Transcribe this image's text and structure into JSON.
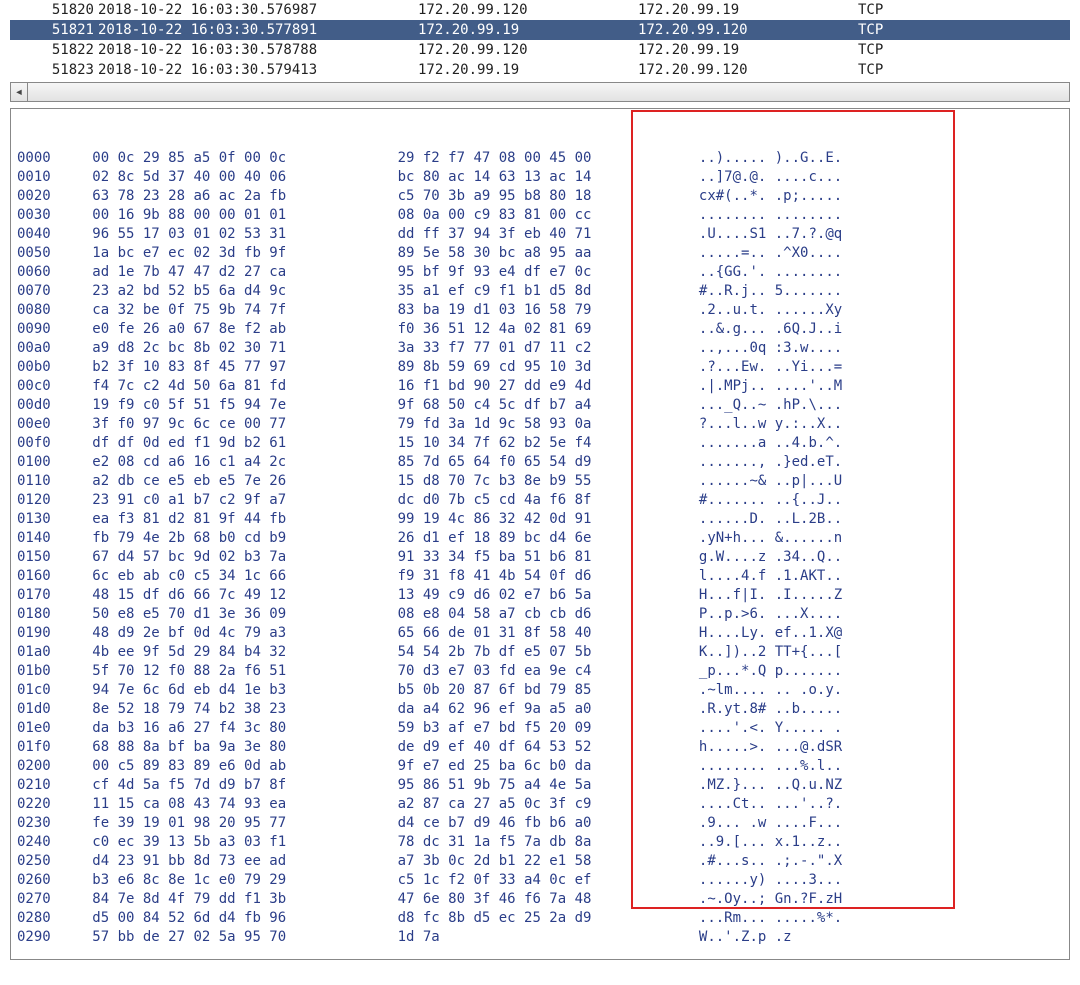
{
  "packet_list": {
    "rows": [
      {
        "no": "51820",
        "time": "2018-10-22 16:03:30.576987",
        "src": "172.20.99.120",
        "dst": "172.20.99.19",
        "proto": "TCP",
        "selected": false
      },
      {
        "no": "51821",
        "time": "2018-10-22 16:03:30.577891",
        "src": "172.20.99.19",
        "dst": "172.20.99.120",
        "proto": "TCP",
        "selected": true
      },
      {
        "no": "51822",
        "time": "2018-10-22 16:03:30.578788",
        "src": "172.20.99.120",
        "dst": "172.20.99.19",
        "proto": "TCP",
        "selected": false
      },
      {
        "no": "51823",
        "time": "2018-10-22 16:03:30.579413",
        "src": "172.20.99.19",
        "dst": "172.20.99.120",
        "proto": "TCP",
        "selected": false
      }
    ]
  },
  "scroll": {
    "left_arrow": "◂"
  },
  "hex_dump": {
    "rows": [
      {
        "off": "0000",
        "b1": "00 0c 29 85 a5 0f 00 0c",
        "b2": "29 f2 f7 47 08 00 45 00",
        "asc": "..)..... )..G..E."
      },
      {
        "off": "0010",
        "b1": "02 8c 5d 37 40 00 40 06",
        "b2": "bc 80 ac 14 63 13 ac 14",
        "asc": "..]7@.@. ....c..."
      },
      {
        "off": "0020",
        "b1": "63 78 23 28 a6 ac 2a fb",
        "b2": "c5 70 3b a9 95 b8 80 18",
        "asc": "cx#(..*. .p;....."
      },
      {
        "off": "0030",
        "b1": "00 16 9b 88 00 00 01 01",
        "b2": "08 0a 00 c9 83 81 00 cc",
        "asc": "........ ........"
      },
      {
        "off": "0040",
        "b1": "96 55 17 03 01 02 53 31",
        "b2": "dd ff 37 94 3f eb 40 71",
        "asc": ".U....S1 ..7.?.@q"
      },
      {
        "off": "0050",
        "b1": "1a bc e7 ec 02 3d fb 9f",
        "b2": "89 5e 58 30 bc a8 95 aa",
        "asc": ".....=.. .^X0...."
      },
      {
        "off": "0060",
        "b1": "ad 1e 7b 47 47 d2 27 ca",
        "b2": "95 bf 9f 93 e4 df e7 0c",
        "asc": "..{GG.'. ........"
      },
      {
        "off": "0070",
        "b1": "23 a2 bd 52 b5 6a d4 9c",
        "b2": "35 a1 ef c9 f1 b1 d5 8d",
        "asc": "#..R.j.. 5......."
      },
      {
        "off": "0080",
        "b1": "ca 32 be 0f 75 9b 74 7f",
        "b2": "83 ba 19 d1 03 16 58 79",
        "asc": ".2..u.t. ......Xy"
      },
      {
        "off": "0090",
        "b1": "e0 fe 26 a0 67 8e f2 ab",
        "b2": "f0 36 51 12 4a 02 81 69",
        "asc": "..&.g... .6Q.J..i"
      },
      {
        "off": "00a0",
        "b1": "a9 d8 2c bc 8b 02 30 71",
        "b2": "3a 33 f7 77 01 d7 11 c2",
        "asc": "..,...0q :3.w...."
      },
      {
        "off": "00b0",
        "b1": "b2 3f 10 83 8f 45 77 97",
        "b2": "89 8b 59 69 cd 95 10 3d",
        "asc": ".?...Ew. ..Yi...="
      },
      {
        "off": "00c0",
        "b1": "f4 7c c2 4d 50 6a 81 fd",
        "b2": "16 f1 bd 90 27 dd e9 4d",
        "asc": ".|.MPj.. ....'..M"
      },
      {
        "off": "00d0",
        "b1": "19 f9 c0 5f 51 f5 94 7e",
        "b2": "9f 68 50 c4 5c df b7 a4",
        "asc": "..._Q..~ .hP.\\..."
      },
      {
        "off": "00e0",
        "b1": "3f f0 97 9c 6c ce 00 77",
        "b2": "79 fd 3a 1d 9c 58 93 0a",
        "asc": "?...l..w y.:..X.."
      },
      {
        "off": "00f0",
        "b1": "df df 0d ed f1 9d b2 61",
        "b2": "15 10 34 7f 62 b2 5e f4",
        "asc": ".......a ..4.b.^."
      },
      {
        "off": "0100",
        "b1": "e2 08 cd a6 16 c1 a4 2c",
        "b2": "85 7d 65 64 f0 65 54 d9",
        "asc": "......., .}ed.eT."
      },
      {
        "off": "0110",
        "b1": "a2 db ce e5 eb e5 7e 26",
        "b2": "15 d8 70 7c b3 8e b9 55",
        "asc": "......~& ..p|...U"
      },
      {
        "off": "0120",
        "b1": "23 91 c0 a1 b7 c2 9f a7",
        "b2": "dc d0 7b c5 cd 4a f6 8f",
        "asc": "#....... ..{..J.."
      },
      {
        "off": "0130",
        "b1": "ea f3 81 d2 81 9f 44 fb",
        "b2": "99 19 4c 86 32 42 0d 91",
        "asc": "......D. ..L.2B.."
      },
      {
        "off": "0140",
        "b1": "fb 79 4e 2b 68 b0 cd b9",
        "b2": "26 d1 ef 18 89 bc d4 6e",
        "asc": ".yN+h... &......n"
      },
      {
        "off": "0150",
        "b1": "67 d4 57 bc 9d 02 b3 7a",
        "b2": "91 33 34 f5 ba 51 b6 81",
        "asc": "g.W....z .34..Q.."
      },
      {
        "off": "0160",
        "b1": "6c eb ab c0 c5 34 1c 66",
        "b2": "f9 31 f8 41 4b 54 0f d6",
        "asc": "l....4.f .1.AKT.."
      },
      {
        "off": "0170",
        "b1": "48 15 df d6 66 7c 49 12",
        "b2": "13 49 c9 d6 02 e7 b6 5a",
        "asc": "H...f|I. .I.....Z"
      },
      {
        "off": "0180",
        "b1": "50 e8 e5 70 d1 3e 36 09",
        "b2": "08 e8 04 58 a7 cb cb d6",
        "asc": "P..p.>6. ...X...."
      },
      {
        "off": "0190",
        "b1": "48 d9 2e bf 0d 4c 79 a3",
        "b2": "65 66 de 01 31 8f 58 40",
        "asc": "H....Ly. ef..1.X@"
      },
      {
        "off": "01a0",
        "b1": "4b ee 9f 5d 29 84 b4 32",
        "b2": "54 54 2b 7b df e5 07 5b",
        "asc": "K..])..2 TT+{...["
      },
      {
        "off": "01b0",
        "b1": "5f 70 12 f0 88 2a f6 51",
        "b2": "70 d3 e7 03 fd ea 9e c4",
        "asc": "_p...*.Q p......."
      },
      {
        "off": "01c0",
        "b1": "94 7e 6c 6d eb d4 1e b3",
        "b2": "b5 0b 20 87 6f bd 79 85",
        "asc": ".~lm.... .. .o.y."
      },
      {
        "off": "01d0",
        "b1": "8e 52 18 79 74 b2 38 23",
        "b2": "da a4 62 96 ef 9a a5 a0",
        "asc": ".R.yt.8# ..b....."
      },
      {
        "off": "01e0",
        "b1": "da b3 16 a6 27 f4 3c 80",
        "b2": "59 b3 af e7 bd f5 20 09",
        "asc": "....'.<. Y..... ."
      },
      {
        "off": "01f0",
        "b1": "68 88 8a bf ba 9a 3e 80",
        "b2": "de d9 ef 40 df 64 53 52",
        "asc": "h.....>. ...@.dSR"
      },
      {
        "off": "0200",
        "b1": "00 c5 89 83 89 e6 0d ab",
        "b2": "9f e7 ed 25 ba 6c b0 da",
        "asc": "........ ...%.l.."
      },
      {
        "off": "0210",
        "b1": "cf 4d 5a f5 7d d9 b7 8f",
        "b2": "95 86 51 9b 75 a4 4e 5a",
        "asc": ".MZ.}... ..Q.u.NZ"
      },
      {
        "off": "0220",
        "b1": "11 15 ca 08 43 74 93 ea",
        "b2": "a2 87 ca 27 a5 0c 3f c9",
        "asc": "....Ct.. ...'..?."
      },
      {
        "off": "0230",
        "b1": "fe 39 19 01 98 20 95 77",
        "b2": "d4 ce b7 d9 46 fb b6 a0",
        "asc": ".9... .w ....F..."
      },
      {
        "off": "0240",
        "b1": "c0 ec 39 13 5b a3 03 f1",
        "b2": "78 dc 31 1a f5 7a db 8a",
        "asc": "..9.[... x.1..z.."
      },
      {
        "off": "0250",
        "b1": "d4 23 91 bb 8d 73 ee ad",
        "b2": "a7 3b 0c 2d b1 22 e1 58",
        "asc": ".#...s.. .;.-.\".X"
      },
      {
        "off": "0260",
        "b1": "b3 e6 8c 8e 1c e0 79 29",
        "b2": "c5 1c f2 0f 33 a4 0c ef",
        "asc": "......y) ....3..."
      },
      {
        "off": "0270",
        "b1": "84 7e 8d 4f 79 dd f1 3b",
        "b2": "47 6e 80 3f 46 f6 7a 48",
        "asc": ".~.Oy..; Gn.?F.zH"
      },
      {
        "off": "0280",
        "b1": "d5 00 84 52 6d d4 fb 96",
        "b2": "d8 fc 8b d5 ec 25 2a d9",
        "asc": "...Rm... .....%*."
      },
      {
        "off": "0290",
        "b1": "57 bb de 27 02 5a 95 70",
        "b2": "1d 7a",
        "asc": "W..'.Z.p .z"
      }
    ]
  }
}
